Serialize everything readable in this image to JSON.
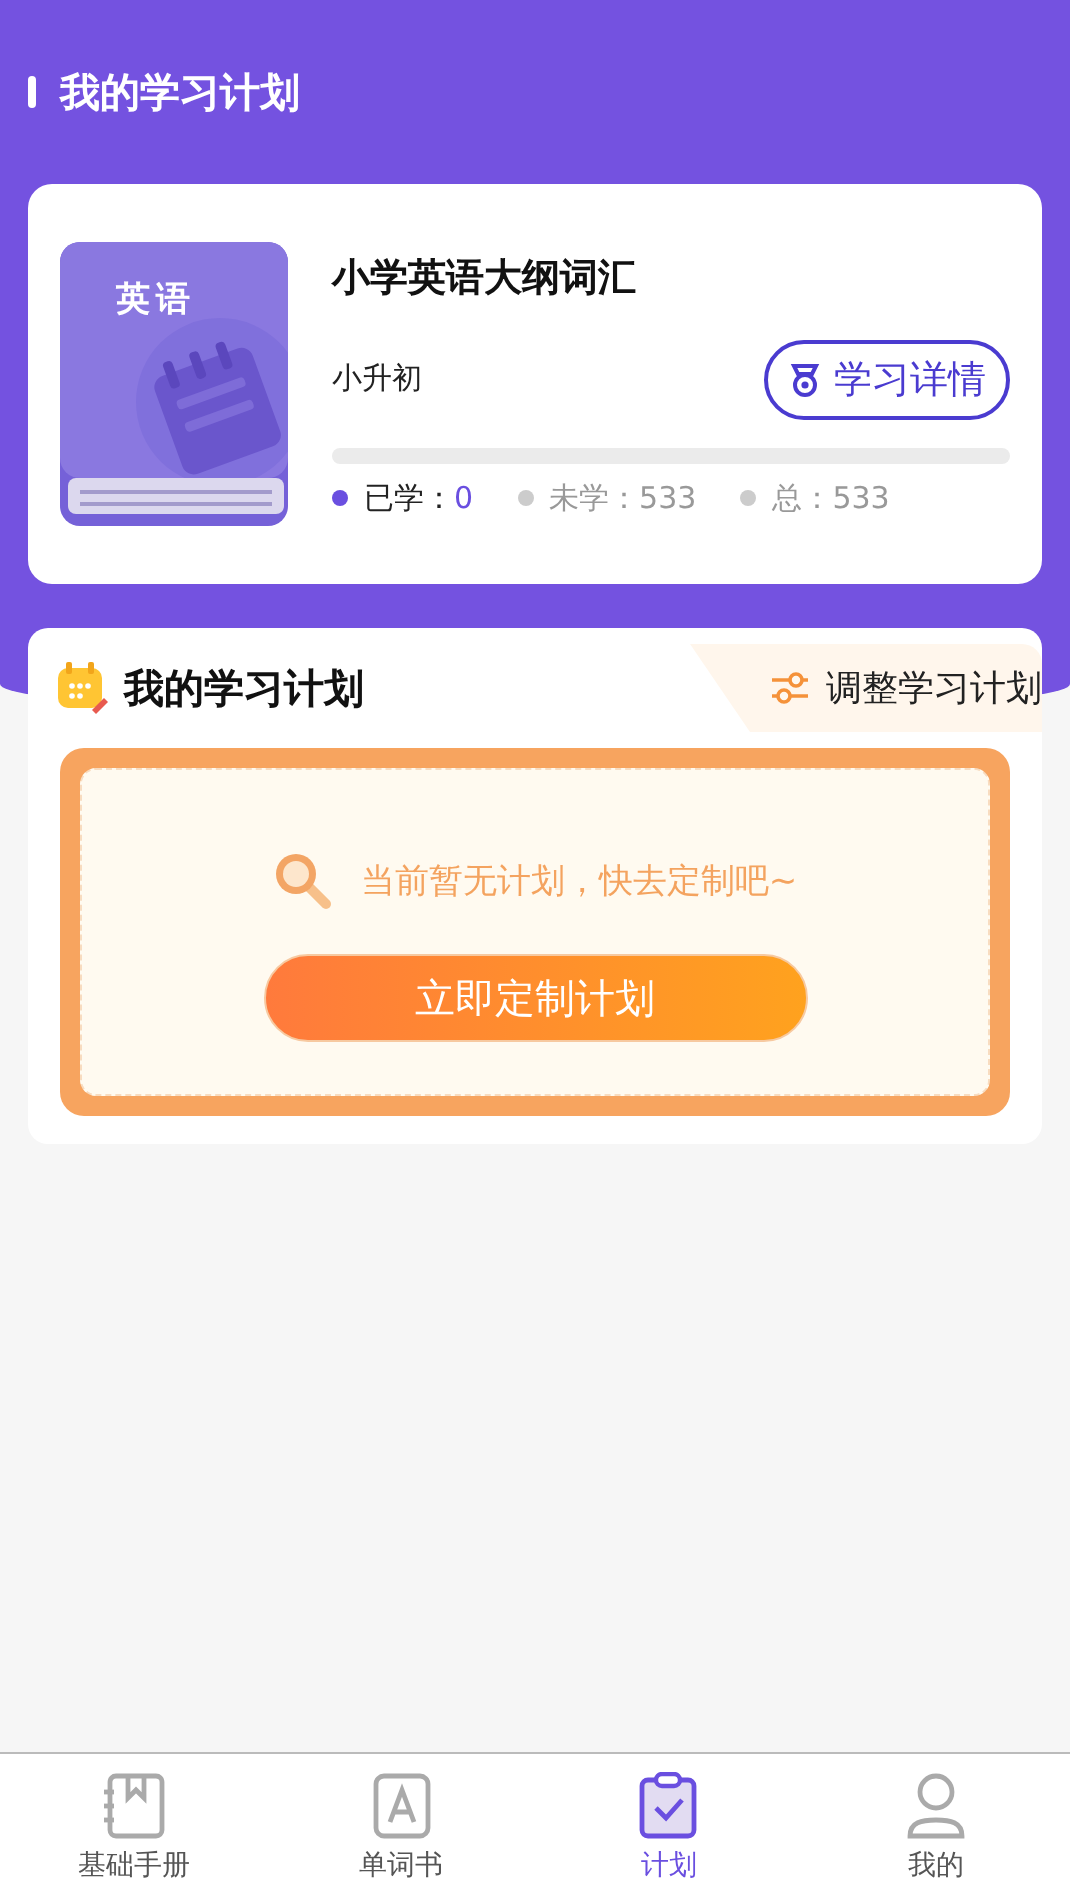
{
  "header": {
    "title": "我的学习计划"
  },
  "book": {
    "cover_label": "英语",
    "title": "小学英语大纲词汇",
    "grade": "小升初",
    "detail_button": "学习详情",
    "level": 0,
    "stats": [
      {
        "label": "已学：",
        "value": "0",
        "kind": "done"
      },
      {
        "label": "未学：",
        "value": "533",
        "kind": "todo"
      },
      {
        "label": "总：",
        "value": "533",
        "kind": "total"
      }
    ]
  },
  "plan": {
    "title": "我的学习计划",
    "adjust": "调整学习计划",
    "empty_text": "当前暂无计划，快去定制吧~",
    "create_button": "立即定制计划"
  },
  "tabs": [
    {
      "label": "基础手册",
      "kind": "notebook",
      "selected": false
    },
    {
      "label": "单词书",
      "kind": "letter",
      "selected": false
    },
    {
      "label": "计划",
      "kind": "clipboard",
      "selected": true
    },
    {
      "label": "我的",
      "kind": "person",
      "selected": false
    }
  ]
}
